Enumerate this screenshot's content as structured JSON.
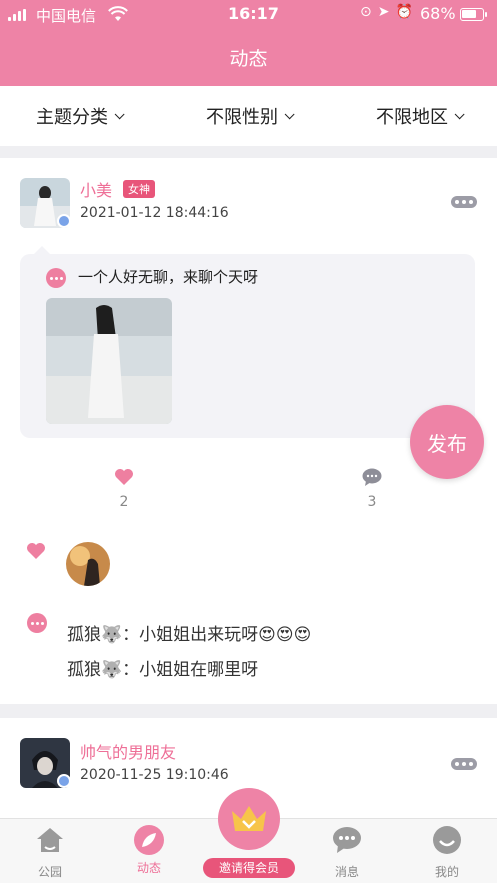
{
  "status_bar": {
    "carrier": "中国电信",
    "time": "16:17",
    "battery": "68%"
  },
  "header": {
    "title": "动态"
  },
  "filters": [
    {
      "label": "主题分类"
    },
    {
      "label": "不限性别"
    },
    {
      "label": "不限地区"
    }
  ],
  "posts": [
    {
      "username": "小美",
      "badge": "女神",
      "time": "2021-01-12 18:44:16",
      "text": "一个人好无聊，来聊个天呀",
      "likes": "2",
      "comments_count": "3",
      "comments": [
        {
          "author": "孤狼🐺",
          "sep": "：",
          "text": "小姐姐出来玩呀😍😍😍"
        },
        {
          "author": "孤狼🐺",
          "sep": "：",
          "text": "小姐姐在哪里呀"
        }
      ]
    },
    {
      "username": "帅气的男朋友",
      "time": "2020-11-25 19:10:46"
    }
  ],
  "fab": {
    "label": "发布"
  },
  "tabbar": {
    "items": [
      {
        "label": "公园"
      },
      {
        "label": "动态"
      },
      {
        "label": "邀请得会员"
      },
      {
        "label": "消息"
      },
      {
        "label": "我的"
      }
    ]
  },
  "colors": {
    "accent": "#ee83a6",
    "badge": "#e8557a",
    "username": "#ee6f97"
  }
}
